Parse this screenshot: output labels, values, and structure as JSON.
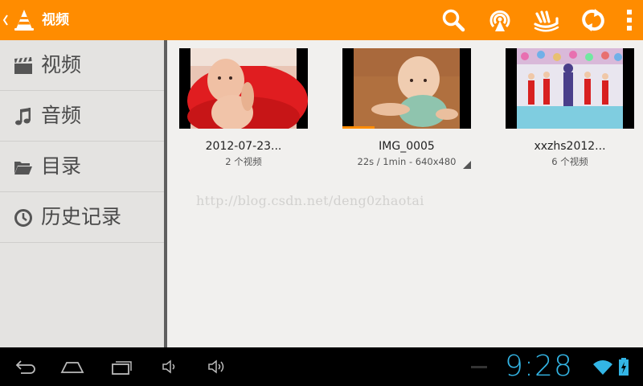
{
  "app": {
    "title": "视频"
  },
  "actionbar": {
    "icons": [
      "search-icon",
      "airplay-icon",
      "hot-icon",
      "refresh-icon",
      "overflow-menu-icon"
    ],
    "accent": "#ff8c00"
  },
  "sidebar": {
    "items": [
      {
        "label": "视频",
        "icon": "video-clapper-icon"
      },
      {
        "label": "音频",
        "icon": "music-note-icon"
      },
      {
        "label": "目录",
        "icon": "folder-icon"
      },
      {
        "label": "历史记录",
        "icon": "history-clock-icon"
      }
    ]
  },
  "videos": [
    {
      "title": "2012-07-23...",
      "subtitle": "2 个视频"
    },
    {
      "title": "IMG_0005",
      "subtitle": "22s / 1min - 640x480",
      "progress": 0.25
    },
    {
      "title": "xxzhs2012...",
      "subtitle": "6 个视频"
    }
  ],
  "watermark": "http://blog.csdn.net/deng0zhaotai",
  "statusbar": {
    "time": "9:28",
    "clock_color": "#33b5e5"
  }
}
